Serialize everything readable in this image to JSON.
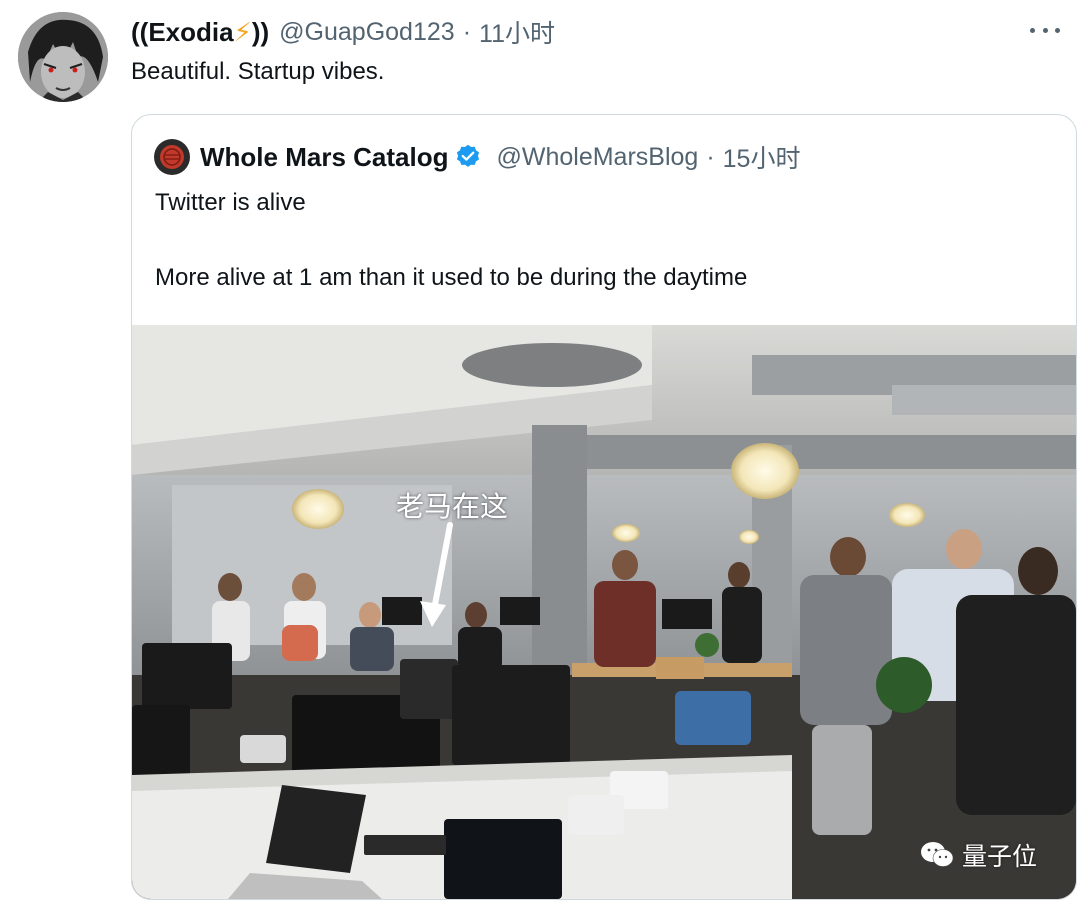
{
  "tweet": {
    "author_name": "((Exodia",
    "author_bolt": "⚡",
    "author_name_suffix": "))",
    "handle": "@GuapGod123",
    "separator": "·",
    "time": "11小时",
    "text": "Beautiful. Startup vibes.",
    "more_icon": "more-horizontal-icon"
  },
  "quoted": {
    "author_name": "Whole Mars Catalog",
    "verified_icon": "verified-badge-icon",
    "handle": "@WholeMarsBlog",
    "separator": "·",
    "time": "15小时",
    "text_line1": "Twitter is alive",
    "text_line2": "More alive at 1 am than it used to be during the daytime",
    "photo": {
      "annotation": "老马在这",
      "watermark": "量子位",
      "watermark_icon": "wechat-icon"
    }
  },
  "colors": {
    "text": "#0f1419",
    "secondary": "#536471",
    "verified": "#1d9bf0",
    "border": "#cfd9de",
    "bolt": "#f5a623"
  }
}
